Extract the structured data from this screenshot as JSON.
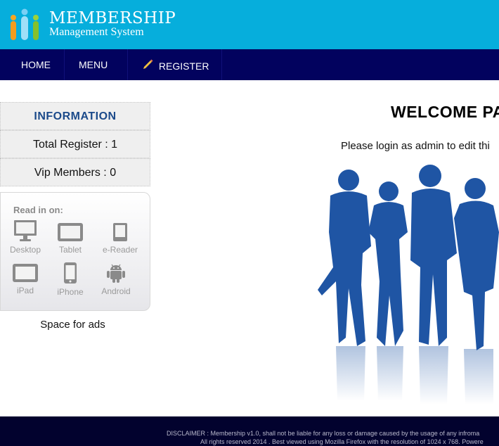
{
  "header": {
    "logo_title": "MEMBERSHIP",
    "logo_subtitle": "Management System",
    "logo_icon": "people-group-icon"
  },
  "nav": {
    "items": [
      {
        "label": "HOME"
      },
      {
        "label": "MENU"
      },
      {
        "label": "REGISTER",
        "icon": "pencil-icon"
      }
    ]
  },
  "sidebar": {
    "info_heading": "INFORMATION",
    "total_register": "Total Register : 1",
    "vip_members": "Vip Members : 0",
    "read_in_label": "Read in on:",
    "devices": [
      {
        "label": "Desktop",
        "icon": "desktop-icon"
      },
      {
        "label": "Tablet",
        "icon": "tablet-icon"
      },
      {
        "label": "e-Reader",
        "icon": "ereader-icon"
      },
      {
        "label": "iPad",
        "icon": "ipad-icon"
      },
      {
        "label": "iPhone",
        "icon": "iphone-icon"
      },
      {
        "label": "Android",
        "icon": "android-icon"
      }
    ],
    "ads_text": "Space for ads"
  },
  "main": {
    "welcome_title": "WELCOME PA",
    "login_note": "Please login as admin to edit thi"
  },
  "footer": {
    "disclaimer": "DISCLAIMER : Membership v1.0, shall not be liable for any loss or damage caused by the usage of any infroma",
    "rights": "All rights reserved 2014 . Best viewed using Mozilla Firefox with the resolution of 1024 x 768. Powere"
  },
  "colors": {
    "header_bg": "#06aedc",
    "nav_bg": "#02025e",
    "footer_bg": "#02022e",
    "heading_blue": "#1b4a8a",
    "silhouette_blue": "#1f55a4"
  }
}
